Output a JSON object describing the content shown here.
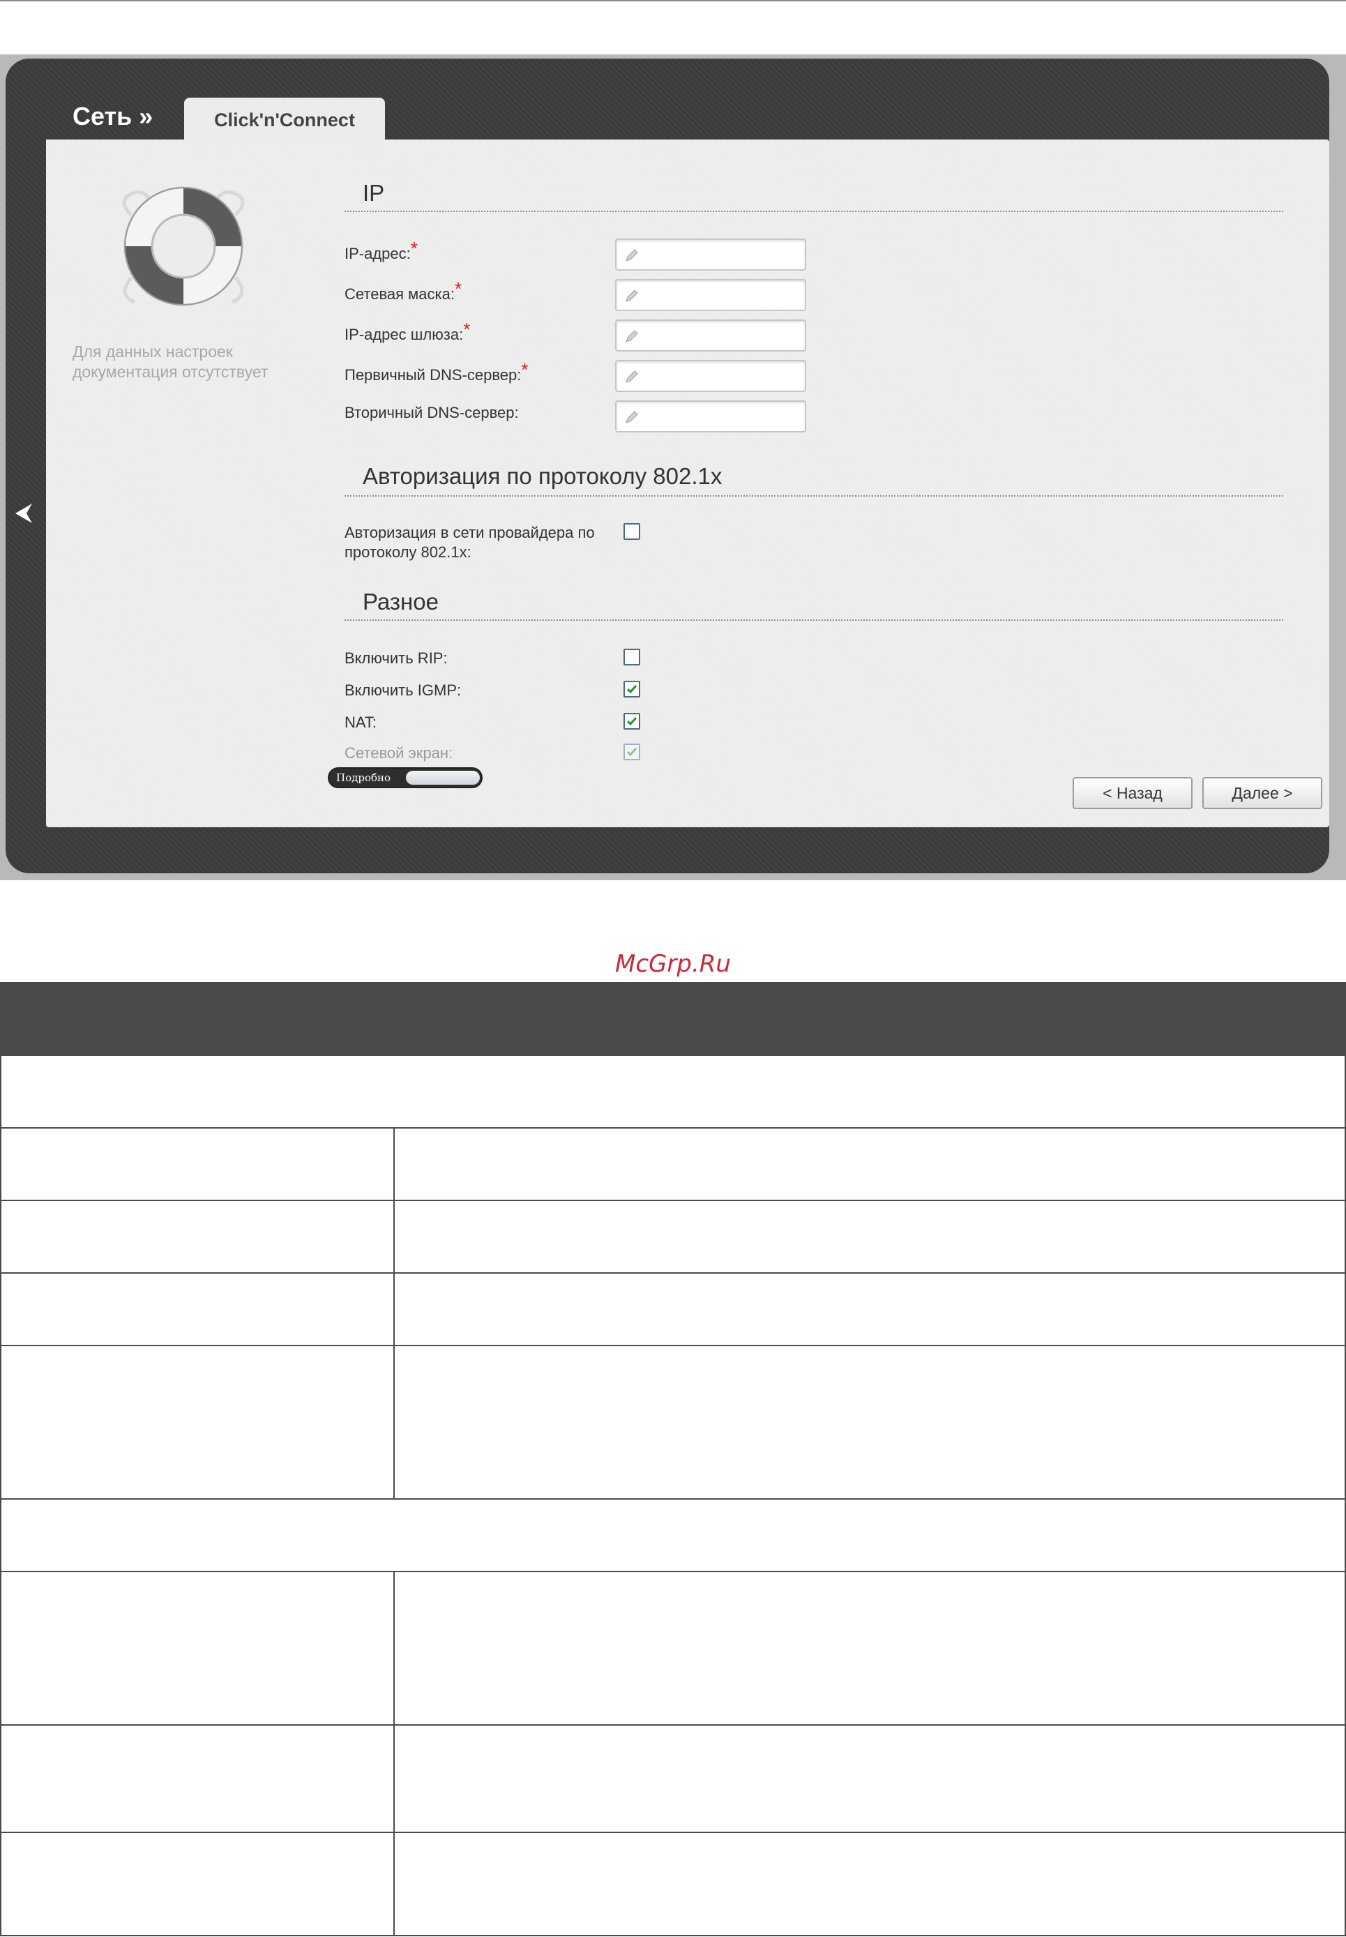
{
  "breadcrumb": {
    "section": "Сеть »",
    "tab": "Click'n'Connect"
  },
  "sidebar": {
    "note": "Для данных настроек документация отсутствует"
  },
  "ip_section": {
    "title": "IP",
    "fields": [
      {
        "label": "IP-адрес:",
        "required": "*",
        "value": ""
      },
      {
        "label": "Сетевая маска:",
        "required": "*",
        "value": ""
      },
      {
        "label": "IP-адрес шлюза:",
        "required": "*",
        "value": ""
      },
      {
        "label": "Первичный DNS-сервер:",
        "required": "*",
        "value": ""
      },
      {
        "label": "Вторичный DNS-сервер:",
        "required": "",
        "value": ""
      }
    ]
  },
  "auth_section": {
    "title": "Авторизация по протоколу 802.1x",
    "label_line1": "Авторизация в сети провайдера по",
    "label_line2": "протоколу 802.1x:",
    "checked": false
  },
  "misc_section": {
    "title": "Разное",
    "options": [
      {
        "label": "Включить RIP:",
        "checked": false
      },
      {
        "label": "Включить IGMP:",
        "checked": true
      },
      {
        "label": "NAT:",
        "checked": true
      },
      {
        "label": "Сетевой экран:",
        "checked": true
      }
    ]
  },
  "details_toggle": {
    "label": "Подробно"
  },
  "buttons": {
    "back": "< Назад",
    "next": "Далее >"
  },
  "watermark": "McGrp.Ru",
  "colors": {
    "accent_red": "#e21b1b",
    "check_green": "#2f8f2f",
    "dark_frame": "#3c3c3c"
  }
}
